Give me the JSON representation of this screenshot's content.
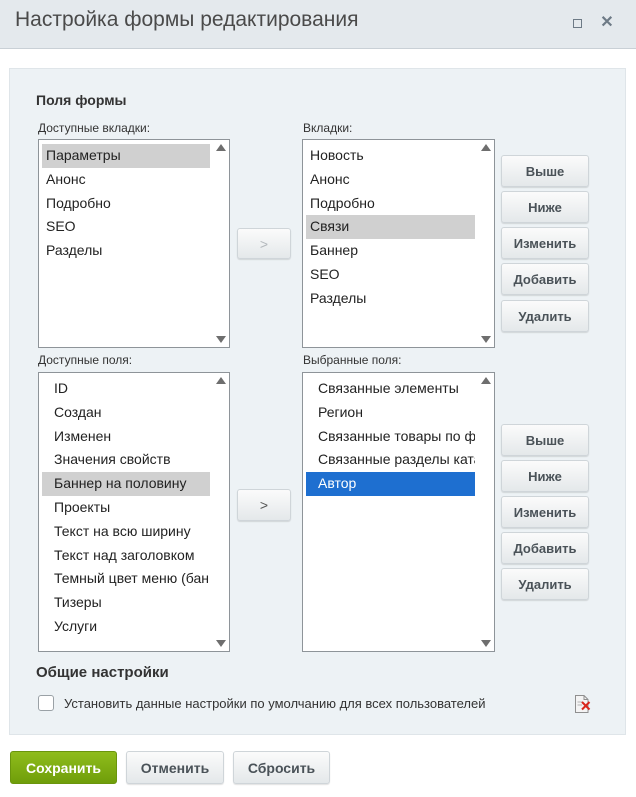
{
  "dialog": {
    "title": "Настройка формы редактирования",
    "maximize_icon": "maximize-icon",
    "close_icon": "close-icon",
    "close_label": "✕"
  },
  "form_fields_section": {
    "title": "Поля формы",
    "available_tabs": {
      "label": "Доступные вкладки:",
      "items": [
        "Параметры",
        "Анонс",
        "Подробно",
        "SEO",
        "Разделы"
      ],
      "selected_index": 0
    },
    "tabs": {
      "label": "Вкладки:",
      "items": [
        "Новость",
        "Анонс",
        "Подробно",
        "Связи",
        "Баннер",
        "SEO",
        "Разделы"
      ],
      "selected_index": 3
    },
    "move_tabs_button": ">",
    "tab_buttons": {
      "up": "Выше",
      "down": "Ниже",
      "edit": "Изменить",
      "add": "Добавить",
      "delete": "Удалить"
    },
    "available_fields": {
      "label": "Доступные поля:",
      "items": [
        "ID",
        "Создан",
        "Изменен",
        "Значения свойств",
        "Баннер на половину",
        "Проекты",
        "Текст на всю ширину",
        "Текст над заголовком",
        "Темный цвет меню (бан",
        "Тизеры",
        "Услуги"
      ],
      "selected_index": 4
    },
    "selected_fields": {
      "label": "Выбранные поля:",
      "items": [
        "Связанные элементы",
        "Регион",
        "Связанные товары по ф",
        "Связанные разделы ката",
        "Автор"
      ],
      "selected_index": 4
    },
    "move_fields_button": ">",
    "field_buttons": {
      "up": "Выше",
      "down": "Ниже",
      "edit": "Изменить",
      "add": "Добавить",
      "delete": "Удалить"
    }
  },
  "general_settings": {
    "title": "Общие настройки",
    "default_for_all_label": "Установить данные настройки по умолчанию для всех пользователей",
    "default_for_all_checked": false,
    "delete_settings_icon": "document-delete-icon"
  },
  "footer": {
    "save": "Сохранить",
    "cancel": "Отменить",
    "reset": "Сбросить"
  },
  "colors": {
    "save_button": "#7aa90f",
    "selection_blue": "#1e6fd0",
    "selection_gray": "#d0d0d0",
    "panel_bg": "#edf2f5",
    "titlebar_bg": "#e4e9ed"
  }
}
